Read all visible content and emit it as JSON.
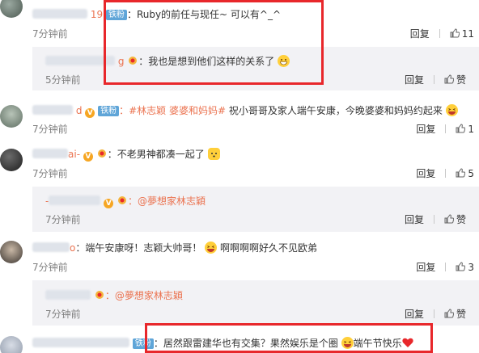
{
  "comments": [
    {
      "user_suffix": "19",
      "badge": "铁粉",
      "text": "：Ruby的前任与现任~ 可以有^_^",
      "time": "7分钟前",
      "reply": "回复",
      "likes": "11"
    },
    {
      "user_suffix": "g",
      "text": "：我也是想到他们这样的关系了",
      "time": "5分钟前",
      "reply": "回复",
      "likes": "赞"
    },
    {
      "user_suffix": "d",
      "badge": "铁粉",
      "text_links": "：#林志颖 婆婆和妈妈#",
      "text": " 祝小哥哥及家人端午安康，今晚婆婆和妈妈约起来",
      "time": "7分钟前",
      "reply": "回复",
      "likes": "1"
    },
    {
      "user_suffix": "ai-",
      "text": "：不老男神都凑一起了",
      "time": "7分钟前",
      "reply": "回复",
      "likes": "5"
    },
    {
      "mention": "：@夢想家林志穎",
      "time": "7分钟前",
      "reply": "回复",
      "likes": "赞"
    },
    {
      "user_suffix": "o",
      "text": "：端午安康呀！志颖大帅哥！",
      "text2": "啊啊啊啊好久不见欧弟",
      "time": "7分钟前",
      "reply": "回复",
      "likes": "3"
    },
    {
      "mention": "：@夢想家林志穎",
      "time": "7分钟前",
      "reply": "回复",
      "likes": "赞"
    },
    {
      "badge": "铁粉",
      "text": "：居然跟雷建华也有交集？果然娱乐是个圈",
      "text2": "端午节快乐"
    }
  ],
  "colors": {
    "username": "#eb7350",
    "highlight_border": "#e8272b",
    "reply_bg": "#f2f2f5"
  }
}
